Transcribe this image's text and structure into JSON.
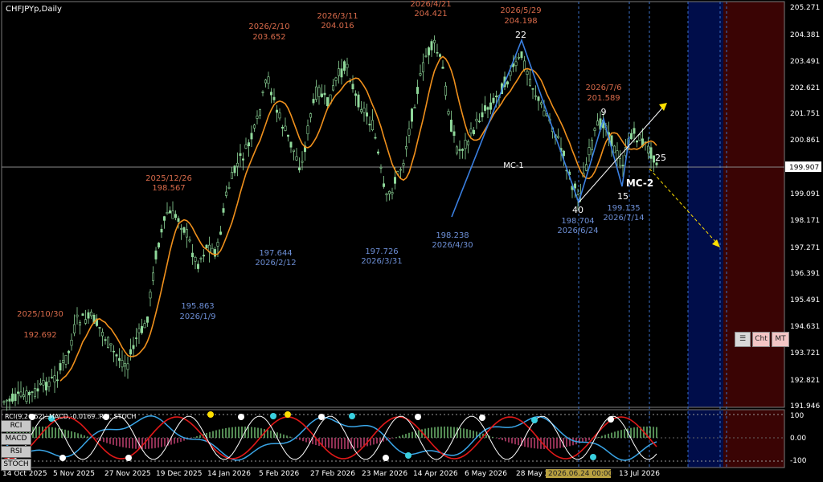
{
  "chart_title": "CHFJPYp,Daily",
  "sub_title": "RCI(9,26,52)..MACD,-0.0169..RSI..STOCH",
  "last_price": "199.907",
  "price_axis": [
    "205.271",
    "204.381",
    "203.491",
    "202.621",
    "201.751",
    "200.861",
    "199.907",
    "199.091",
    "198.171",
    "197.271",
    "196.391",
    "195.491",
    "194.631",
    "193.721",
    "192.821",
    "191.946"
  ],
  "sub_axis": {
    "top": "100",
    "mid": "0.00",
    "bottom": "-100"
  },
  "dates": [
    "14 Oct 2025",
    "5 Nov 2025",
    "27 Nov 2025",
    "19 Dec 2025",
    "14 Jan 2026",
    "5 Feb 2026",
    "27 Feb 2026",
    "23 Mar 2026",
    "14 Apr 2026",
    "6 May 2026",
    "28 May 2026",
    "2026.06.24 00:00",
    "13 Jul 2026"
  ],
  "annotations": {
    "highs": [
      {
        "date": "2025/10/30",
        "price": "192.692"
      },
      {
        "date": "2025/12/26",
        "price": "198.567"
      },
      {
        "date": "2026/2/10",
        "price": "203.652"
      },
      {
        "date": "2026/3/11",
        "price": "204.016"
      },
      {
        "date": "2026/4/21",
        "price": "204.421"
      },
      {
        "date": "2026/5/29",
        "price": "204.198"
      },
      {
        "date": "2026/7/6",
        "price": "201.589"
      }
    ],
    "lows": [
      {
        "date": "2026/1/9",
        "price": "195.863"
      },
      {
        "date": "2026/2/12",
        "price": "197.644"
      },
      {
        "date": "2026/3/31",
        "price": "197.726"
      },
      {
        "date": "2026/4/30",
        "price": "198.238"
      },
      {
        "date": "2026/6/24",
        "price": "198.704"
      },
      {
        "date": "2026/7/14",
        "price": "199.135"
      }
    ],
    "counts": [
      "22",
      "40",
      "9",
      "15",
      "25"
    ],
    "mc1": "MC-1",
    "mc2": "MC-2"
  },
  "controls": {
    "menu_icon": "menu-icon",
    "cht": "Cht",
    "mt": "MT"
  },
  "sub_menu": [
    "RCI",
    "MACD",
    "RSI",
    "STOCH"
  ],
  "colors": {
    "bull": "#8fd89a",
    "ma": "#f0901c",
    "zz": "#3a7fe0",
    "high_label": "#d86a4a",
    "low_label": "#6d8fd6",
    "zone_blue": "#000d4a",
    "zone_red": "#3a0404"
  }
}
